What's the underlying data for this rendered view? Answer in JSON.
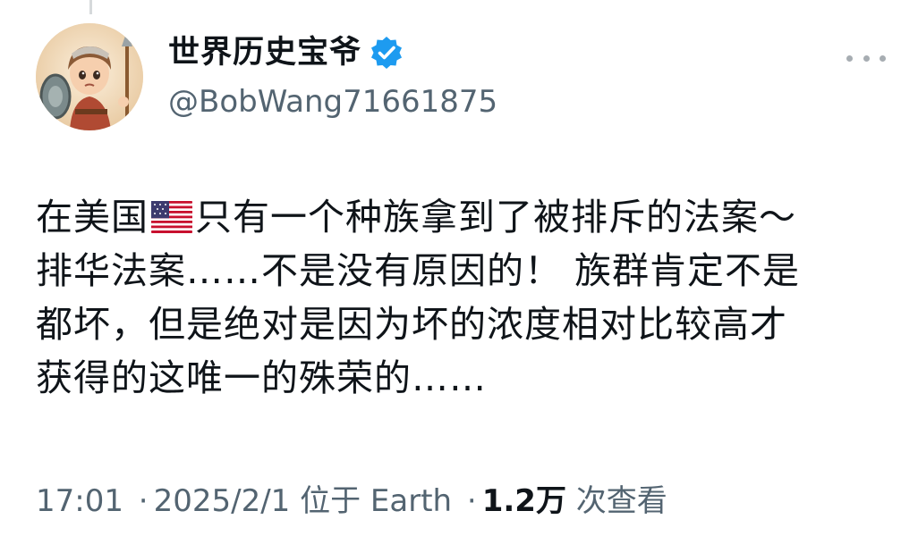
{
  "author": {
    "display_name": "世界历史宝爷",
    "handle": "@BobWang71661875",
    "verified": true,
    "avatar_description_icon": "avatar-icon"
  },
  "tweet": {
    "lines": [
      {
        "before_flag": "在美国",
        "flag": "us-flag-icon",
        "after_flag": "只有一个种族拿到了被排斥的法案～"
      },
      {
        "text": "排华法案……不是没有原因的！ 族群肯定不是"
      },
      {
        "text": "都坏，但是绝对是因为坏的浓度相对比较高才"
      },
      {
        "text": "获得的这唯一的殊荣的……"
      }
    ]
  },
  "meta": {
    "time": "17:01",
    "date": "2025/2/1",
    "location": "位于 Earth",
    "views_count": "1.2万",
    "views_label": "次查看",
    "separator": "·"
  },
  "colors": {
    "verified_blue": "#1d9bf0",
    "secondary_text": "#536471",
    "primary_text": "#0f1419"
  }
}
